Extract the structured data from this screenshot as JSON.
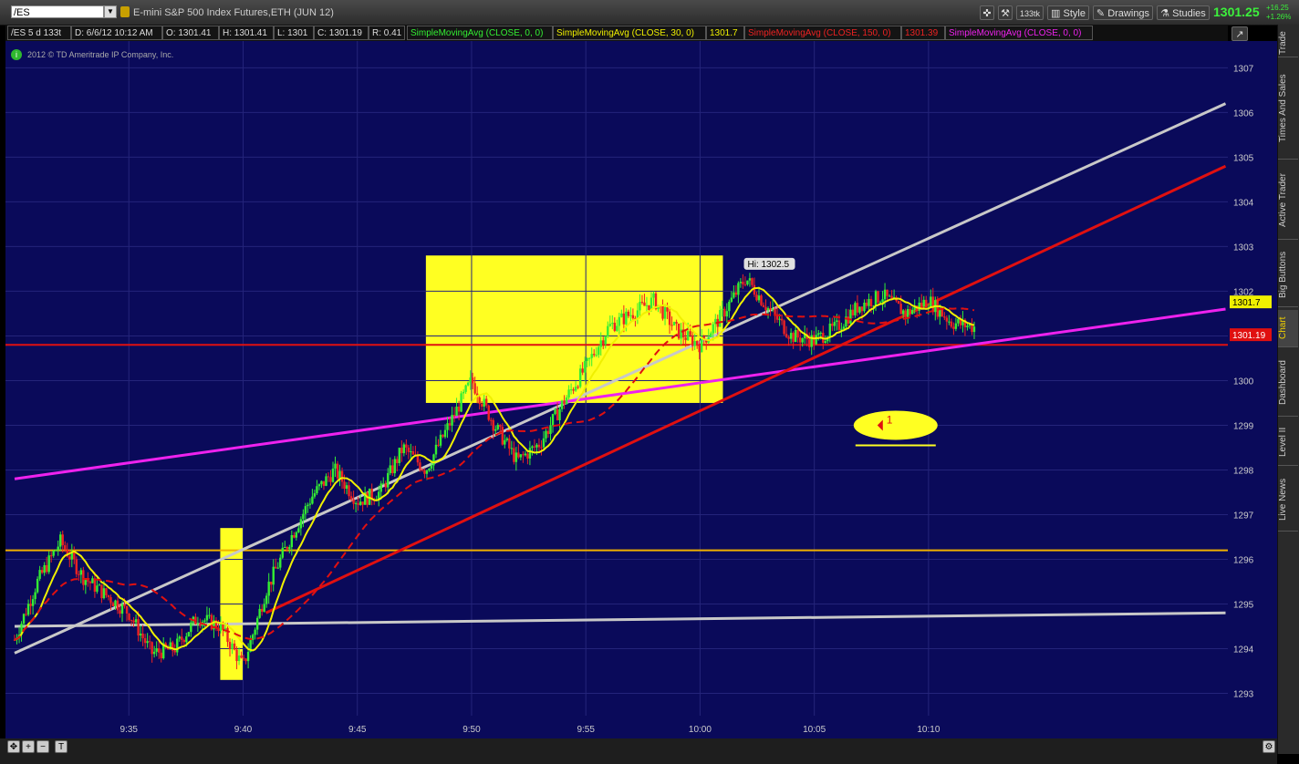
{
  "toolbar": {
    "symbol": "/ES",
    "instrument": "E-mini S&P 500 Index Futures,ETH (JUN 12)",
    "aggregation": "133tk",
    "style_label": "Style",
    "drawings_label": "Drawings",
    "studies_label": "Studies",
    "last_price": "1301.25",
    "change": "+16.25",
    "change_pct": "+1.26%"
  },
  "infobar": {
    "chart_id": "/ES 5 d 133t",
    "date": "D: 6/6/12 10:12 AM",
    "open": "O: 1301.41",
    "high": "H: 1301.41",
    "low": "L: 1301",
    "close": "C: 1301.19",
    "range": "R: 0.41",
    "sma1_label": "SimpleMovingAvg (CLOSE, 0, 0)",
    "sma2_label": "SimpleMovingAvg (CLOSE, 30, 0)",
    "sma2_value": "1301.7",
    "sma3_label": "SimpleMovingAvg (CLOSE, 150, 0)",
    "sma3_value": "1301.39",
    "sma4_label": "SimpleMovingAvg (CLOSE, 0, 0)"
  },
  "copyright": "2012 © TD Ameritrade IP Company, Inc.",
  "side_tabs": [
    "Trade",
    "Times And Sales",
    "Active Trader",
    "Big Buttons",
    "Chart",
    "Dashboard",
    "Level II",
    "Live News"
  ],
  "colors": {
    "background": "#0a0a5a",
    "up_bar": "#33ee33",
    "down_bar": "#ee2222",
    "sma30": "#f0f000",
    "sma150": "#e01010",
    "trend_gray": "#c8c8c8",
    "trend_red": "#e01010",
    "trend_magenta": "#ee22ee",
    "horizontal_orange": "#f0b000",
    "highlight_yellow": "#ffff22"
  },
  "chart_data": {
    "type": "candlestick",
    "title": "",
    "ylim": [
      1292.5,
      1307.6
    ],
    "y_ticks": [
      "1293",
      "1294",
      "1295",
      "1296",
      "1297",
      "1298",
      "1299",
      "1300",
      "1301",
      "1302",
      "1303",
      "1304",
      "1305",
      "1306",
      "1307"
    ],
    "x_ticks": [
      "9:35",
      "9:40",
      "9:45",
      "9:50",
      "9:55",
      "10:00",
      "10:05",
      "10:10"
    ],
    "hi_label": "Hi: 1302.5",
    "price_tag_sma30": "1301.7",
    "price_tag_sma150": "1301.19",
    "annotation_text": "1",
    "price_path": [
      {
        "t": "9:30",
        "v": 1294.2
      },
      {
        "t": "9:31",
        "v": 1295.5
      },
      {
        "t": "9:32",
        "v": 1296.4
      },
      {
        "t": "9:33",
        "v": 1295.6
      },
      {
        "t": "9:34",
        "v": 1295.2
      },
      {
        "t": "9:35",
        "v": 1294.8
      },
      {
        "t": "9:36",
        "v": 1293.9
      },
      {
        "t": "9:37",
        "v": 1294.0
      },
      {
        "t": "9:38",
        "v": 1294.7
      },
      {
        "t": "9:39",
        "v": 1294.5
      },
      {
        "t": "9:40",
        "v": 1293.6
      },
      {
        "t": "9:41",
        "v": 1295.3
      },
      {
        "t": "9:42",
        "v": 1296.4
      },
      {
        "t": "9:43",
        "v": 1297.4
      },
      {
        "t": "9:44",
        "v": 1298.0
      },
      {
        "t": "9:45",
        "v": 1297.3
      },
      {
        "t": "9:46",
        "v": 1297.5
      },
      {
        "t": "9:47",
        "v": 1298.5
      },
      {
        "t": "9:48",
        "v": 1298.0
      },
      {
        "t": "9:49",
        "v": 1299.0
      },
      {
        "t": "9:50",
        "v": 1300.0
      },
      {
        "t": "9:51",
        "v": 1299.0
      },
      {
        "t": "9:52",
        "v": 1298.2
      },
      {
        "t": "9:53",
        "v": 1298.6
      },
      {
        "t": "9:54",
        "v": 1299.5
      },
      {
        "t": "9:55",
        "v": 1300.3
      },
      {
        "t": "9:56",
        "v": 1301.2
      },
      {
        "t": "9:57",
        "v": 1301.5
      },
      {
        "t": "9:58",
        "v": 1301.8
      },
      {
        "t": "9:59",
        "v": 1301.1
      },
      {
        "t": "10:00",
        "v": 1300.8
      },
      {
        "t": "10:01",
        "v": 1301.5
      },
      {
        "t": "10:02",
        "v": 1302.3
      },
      {
        "t": "10:03",
        "v": 1301.6
      },
      {
        "t": "10:04",
        "v": 1301.0
      },
      {
        "t": "10:05",
        "v": 1300.9
      },
      {
        "t": "10:06",
        "v": 1301.2
      },
      {
        "t": "10:07",
        "v": 1301.7
      },
      {
        "t": "10:08",
        "v": 1301.9
      },
      {
        "t": "10:09",
        "v": 1301.5
      },
      {
        "t": "10:10",
        "v": 1301.8
      },
      {
        "t": "10:11",
        "v": 1301.3
      },
      {
        "t": "10:12",
        "v": 1301.2
      }
    ],
    "horizontal_lines": [
      {
        "name": "orange level",
        "y": 1296.2,
        "color": "#f0b000"
      },
      {
        "name": "red level",
        "y": 1300.8,
        "color": "#e01010"
      }
    ],
    "trend_lines": [
      {
        "name": "gray upper",
        "from": {
          "t": "9:30",
          "v": 1293.9
        },
        "to": {
          "t": "10:23",
          "v": 1306.2
        },
        "color": "#c8c8c8"
      },
      {
        "name": "gray lower",
        "from": {
          "t": "9:30",
          "v": 1294.5
        },
        "to": {
          "t": "10:23",
          "v": 1294.8
        },
        "color": "#c8c8c8"
      },
      {
        "name": "magenta",
        "from": {
          "t": "9:30",
          "v": 1297.8
        },
        "to": {
          "t": "10:23",
          "v": 1301.6
        },
        "color": "#ee22ee"
      },
      {
        "name": "red channel",
        "from": {
          "t": "9:41",
          "v": 1294.8
        },
        "to": {
          "t": "10:23",
          "v": 1304.8
        },
        "color": "#e01010"
      }
    ],
    "highlight_boxes": [
      {
        "from": "9:39",
        "to": "9:40",
        "y_low": 1293.3,
        "y_high": 1296.7
      },
      {
        "from": "9:48",
        "to": "10:01",
        "y_low": 1299.5,
        "y_high": 1302.8
      }
    ]
  }
}
